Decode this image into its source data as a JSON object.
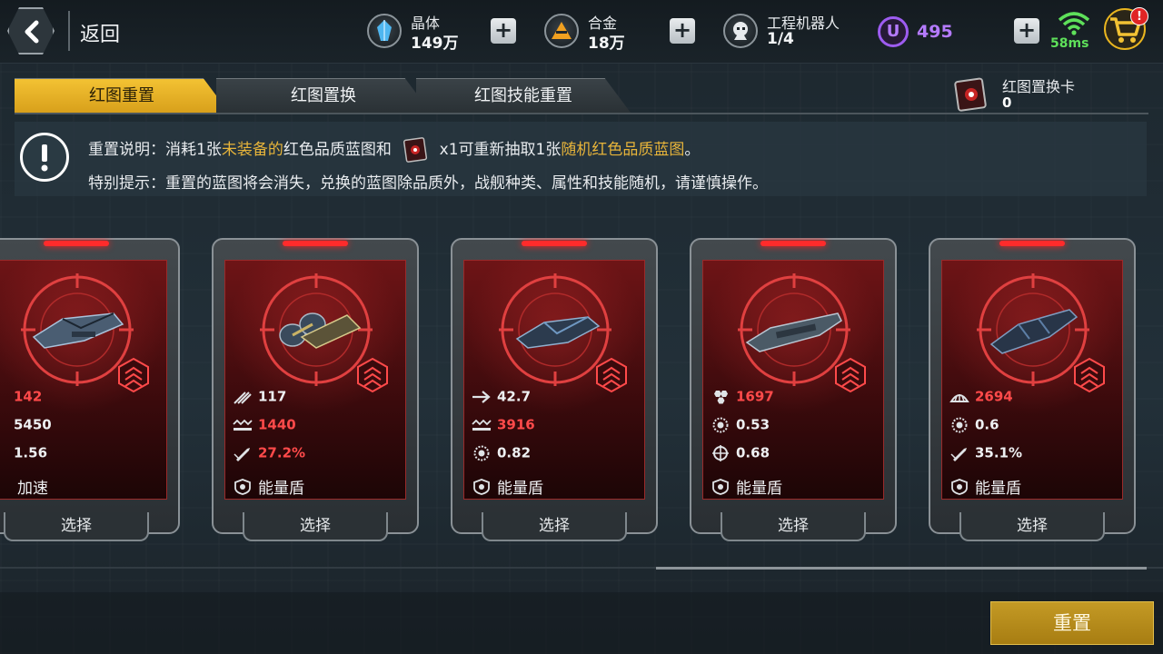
{
  "topbar": {
    "back_label": "返回",
    "resources": [
      {
        "name": "晶体",
        "value": "149万",
        "icon": "crystal-icon",
        "color": "#4fb6f0"
      },
      {
        "name": "合金",
        "value": "18万",
        "icon": "alloy-icon",
        "color": "#f0a020"
      },
      {
        "name": "工程机器人",
        "value": "1/4",
        "icon": "robot-icon"
      }
    ],
    "u_currency": {
      "symbol": "U",
      "value": "495",
      "color": "#b57bff"
    },
    "ping": "58ms",
    "cart_badge": "!"
  },
  "tabs": [
    {
      "label": "红图重置",
      "active": true
    },
    {
      "label": "红图置换",
      "active": false
    },
    {
      "label": "红图技能重置",
      "active": false
    }
  ],
  "swap_card": {
    "label": "红图置换卡",
    "count": "0"
  },
  "info": {
    "line1_prefix": "重置说明：消耗1张",
    "line1_hl1": "未装备的",
    "line1_mid": "红色品质蓝图和",
    "line1_after_icon": "x1可重新抽取1张",
    "line1_hl2": "随机红色品质蓝图",
    "line1_end": "。",
    "line2": "特别提示：重置的蓝图将会消失，兑换的蓝图除品质外，战舰种类、属性和技能随机，请谨慎操作。"
  },
  "cards": [
    {
      "stats": [
        {
          "icon": "speed-icon",
          "value": "142",
          "color": "red"
        },
        {
          "icon": "firepower-icon",
          "value": "5450",
          "color": "white"
        },
        {
          "icon": "accuracy-icon",
          "value": "1.56",
          "color": "white"
        }
      ],
      "skill": "加速",
      "select": "选择"
    },
    {
      "stats": [
        {
          "icon": "missile-icon",
          "value": "117",
          "color": "white"
        },
        {
          "icon": "firepower-icon",
          "value": "1440",
          "color": "red"
        },
        {
          "icon": "rocket-icon",
          "value": "27.2%",
          "color": "red"
        }
      ],
      "skill": "能量盾",
      "select": "选择"
    },
    {
      "stats": [
        {
          "icon": "arrow-icon",
          "value": "42.7",
          "color": "white"
        },
        {
          "icon": "firepower-icon",
          "value": "3916",
          "color": "red"
        },
        {
          "icon": "gear-icon",
          "value": "0.82",
          "color": "white"
        }
      ],
      "skill": "能量盾",
      "select": "选择"
    },
    {
      "stats": [
        {
          "icon": "hexagon-icon",
          "value": "1697",
          "color": "red"
        },
        {
          "icon": "gear-icon",
          "value": "0.53",
          "color": "white"
        },
        {
          "icon": "crosshair-icon",
          "value": "0.68",
          "color": "white"
        }
      ],
      "skill": "能量盾",
      "select": "选择"
    },
    {
      "stats": [
        {
          "icon": "armor-icon",
          "value": "2694",
          "color": "red"
        },
        {
          "icon": "gear-icon",
          "value": "0.6",
          "color": "white"
        },
        {
          "icon": "rocket-icon",
          "value": "35.1%",
          "color": "white"
        }
      ],
      "skill": "能量盾",
      "select": "选择"
    }
  ],
  "reset_button": "重置"
}
